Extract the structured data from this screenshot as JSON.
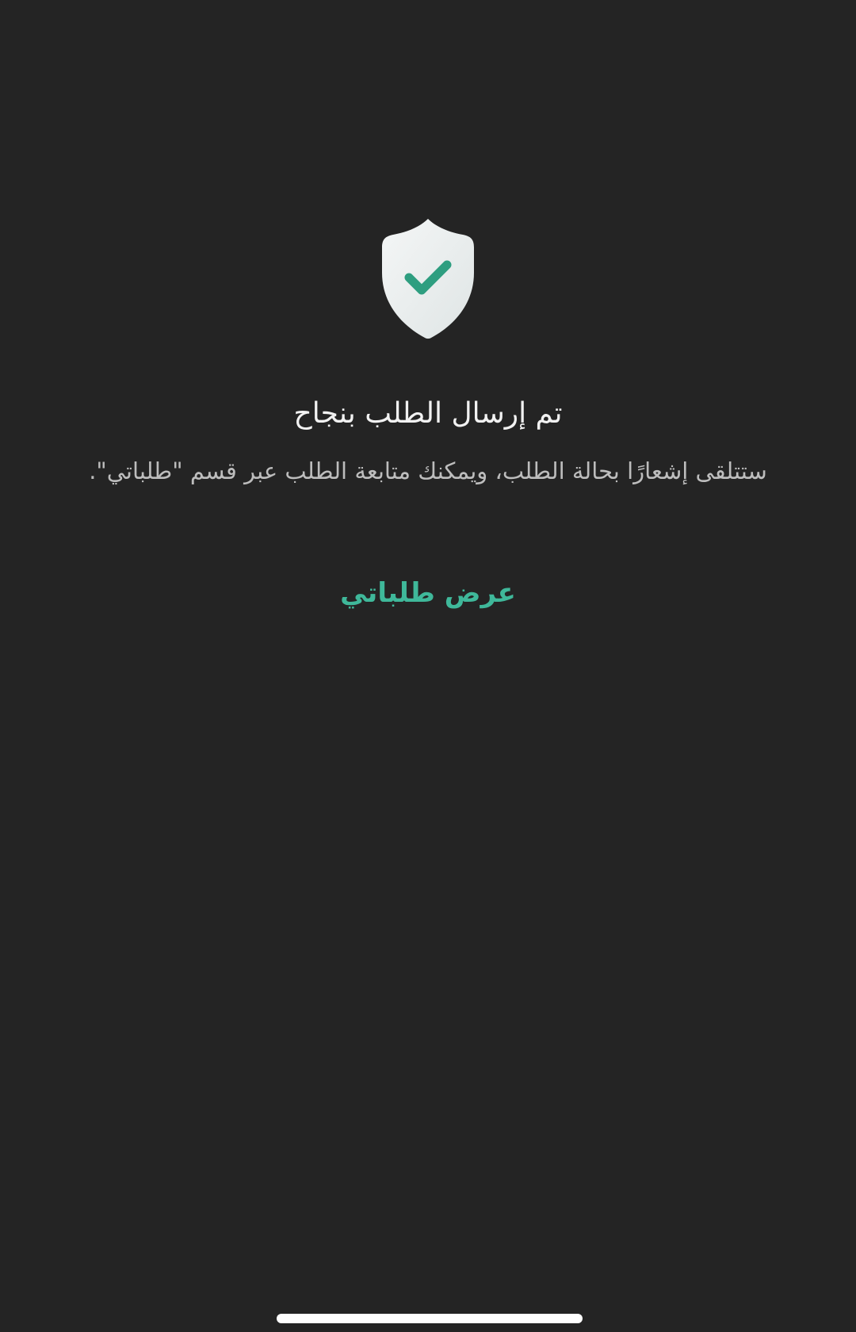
{
  "success": {
    "icon": "shield-check-icon",
    "title": "تم إرسال الطلب بنجاح",
    "message": "ستتلقى إشعارًا بحالة الطلب، ويمكنك متابعة الطلب عبر قسم \"طلباتي\"."
  },
  "actions": {
    "view_orders_label": "عرض طلباتي"
  },
  "colors": {
    "background": "#242424",
    "accent": "#3fb89a",
    "shield": "#e8ecec"
  }
}
